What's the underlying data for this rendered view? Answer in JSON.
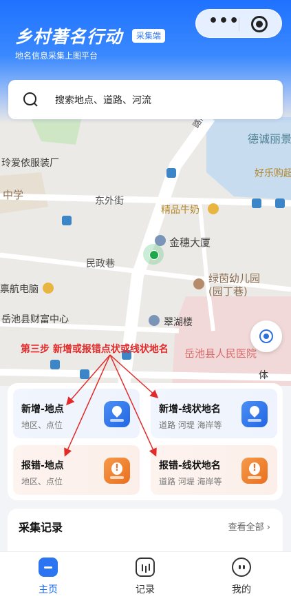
{
  "header": {
    "title": "乡村著名行动",
    "badge": "采集端",
    "subtitle": "地名信息采集上图平台",
    "capsule_more": "•••"
  },
  "search": {
    "placeholder": "搜索地点、道路、河流"
  },
  "map": {
    "labels": {
      "lushangdao": "路尚道",
      "decheng": "德诚丽景",
      "lingai": "玲爱依服装厂",
      "haole": "好乐购超",
      "zhongxue": "中学",
      "dongwai": "东外街",
      "jingpin": "精品牛奶",
      "jinsui": "金穗大厦",
      "minzheng": "民政巷",
      "lvyin1": "绿茵幼儿园",
      "lvyin2": "(园丁巷)",
      "hanghang": "禀航电脑",
      "caifu": "岳池县财富中心",
      "cuihu": "翠湖楼",
      "hospital": "岳池县人民医院",
      "ti": "体"
    },
    "bus_glyph": "■"
  },
  "annotation": {
    "text": "第三步 新增或报错点状或线状地名",
    "color": "#e12a2a"
  },
  "actions": [
    {
      "title": "新增-地点",
      "subtitle": "地区、点位",
      "icon": "location-add-icon",
      "theme": "blue"
    },
    {
      "title": "新增-线状地名",
      "subtitle": "道路 河堤 海岸等",
      "icon": "line-add-icon",
      "theme": "blue"
    },
    {
      "title": "报错-地点",
      "subtitle": "地区、点位",
      "icon": "location-error-icon",
      "theme": "orange"
    },
    {
      "title": "报错-线状地名",
      "subtitle": "道路 河堤 海岸等",
      "icon": "line-error-icon",
      "theme": "orange"
    }
  ],
  "records": {
    "title": "采集记录",
    "view_all": "查看全部 ›"
  },
  "tabbar": {
    "items": [
      {
        "label": "主页",
        "icon": "home-icon",
        "active": true
      },
      {
        "label": "记录",
        "icon": "records-icon",
        "active": false
      },
      {
        "label": "我的",
        "icon": "profile-icon",
        "active": false
      }
    ]
  },
  "colors": {
    "primary": "#1a6cf0",
    "orange": "#e9701f",
    "map_bg": "#eceae6"
  }
}
